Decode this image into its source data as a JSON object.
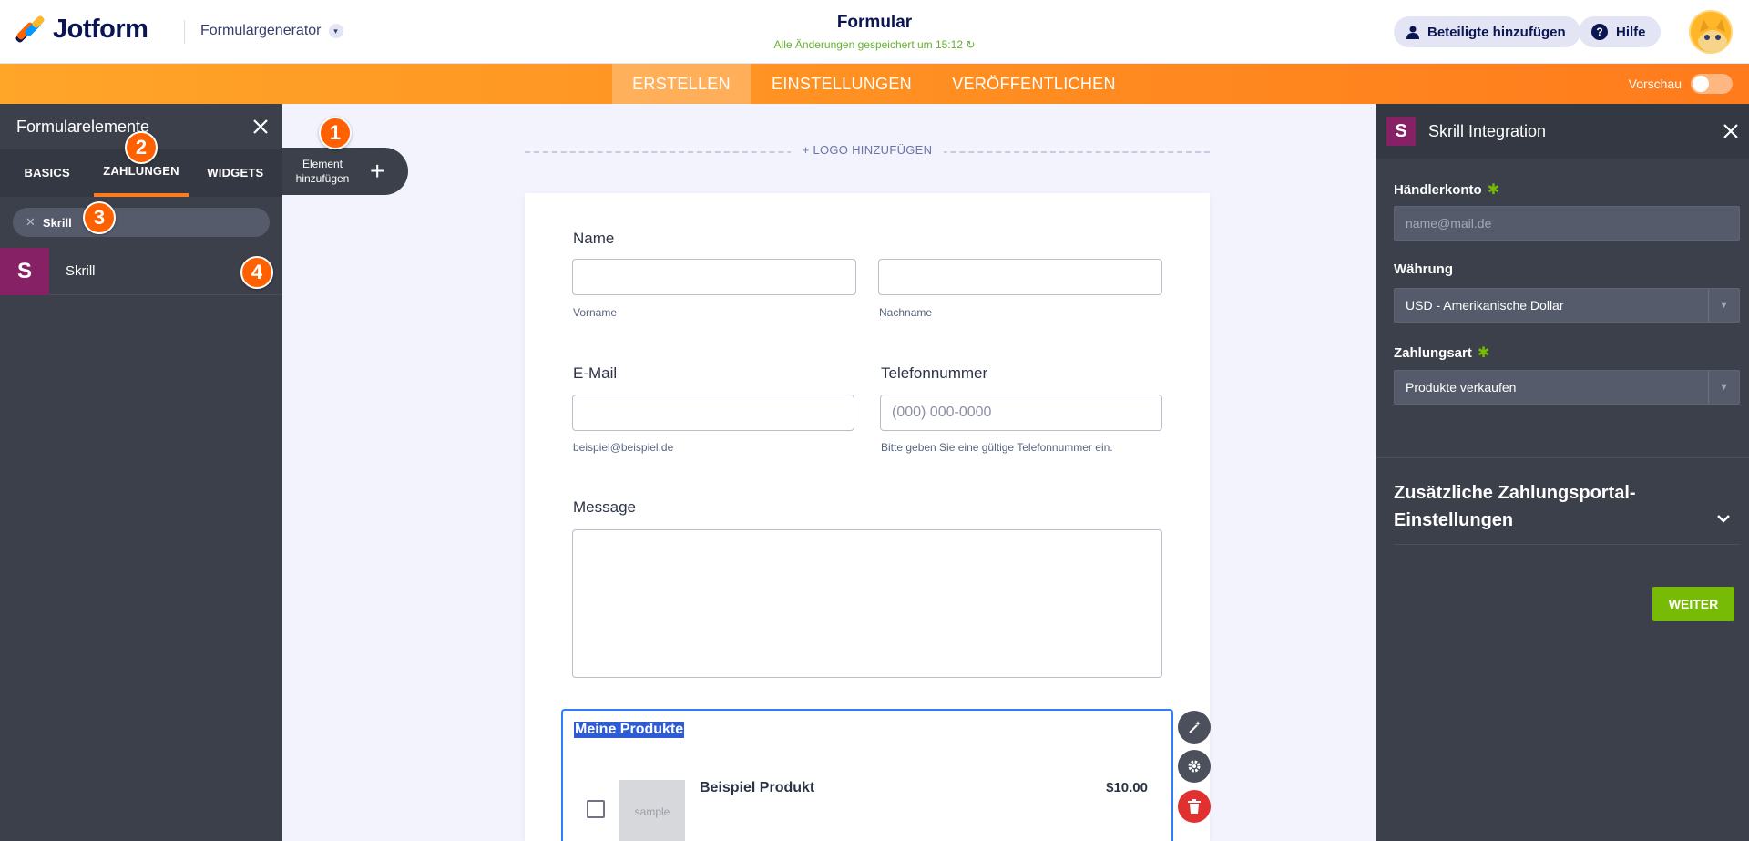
{
  "header": {
    "logo_text": "Jotform",
    "form_generator_label": "Formulargenerator",
    "form_title": "Formular",
    "saved_status": "Alle Änderungen gespeichert um 15:12",
    "participants_button": "Beteiligte hinzufügen",
    "help_button": "Hilfe",
    "icons": [
      "user-icon",
      "help-icon",
      "refresh-icon",
      "chevron-down-icon"
    ]
  },
  "navbar": {
    "tabs": [
      "ERSTELLEN",
      "EINSTELLUNGEN",
      "VERÖFFENTLICHEN"
    ],
    "active_tab": "ERSTELLEN",
    "preview_label": "Vorschau",
    "preview_on": false
  },
  "left_panel": {
    "title": "Formularelemente",
    "tabs": [
      "BASICS",
      "ZAHLUNGEN",
      "WIDGETS"
    ],
    "active_tab": "ZAHLUNGEN",
    "search_value": "Skrill",
    "items": [
      {
        "icon_letter": "S",
        "label": "Skrill"
      }
    ],
    "add_element_label": "Element hinzufügen"
  },
  "badges": [
    "1",
    "2",
    "3",
    "4"
  ],
  "canvas": {
    "logo_add": "+ LOGO HINZUFÜGEN",
    "name_label": "Name",
    "first_name_sub": "Vorname",
    "last_name_sub": "Nachname",
    "email_label": "E-Mail",
    "email_sub": "beispiel@beispiel.de",
    "phone_label": "Telefonnummer",
    "phone_placeholder": "(000) 000-0000",
    "phone_sub": "Bitte geben Sie eine gültige Telefonnummer ein.",
    "message_label": "Message",
    "products_title": "Meine Produkte",
    "product_name": "Beispiel Produkt",
    "product_price": "$10.00",
    "product_image_text": "sample"
  },
  "right_panel": {
    "title": "Skrill Integration",
    "icon_letter": "S",
    "merchant_label": "Händlerkonto",
    "merchant_placeholder": "name@mail.de",
    "currency_label": "Währung",
    "currency_value": "USD - Amerikanische Dollar",
    "payment_type_label": "Zahlungsart",
    "payment_type_value": "Produkte verkaufen",
    "additional_settings": "Zusätzliche Zahlungsportal-Einstellungen",
    "next_button": "WEITER"
  },
  "colors": {
    "orange": "#ff7b1c",
    "skrill": "#862165",
    "green": "#78bb07",
    "panel": "#3c404b",
    "badge": "#ff6100"
  }
}
